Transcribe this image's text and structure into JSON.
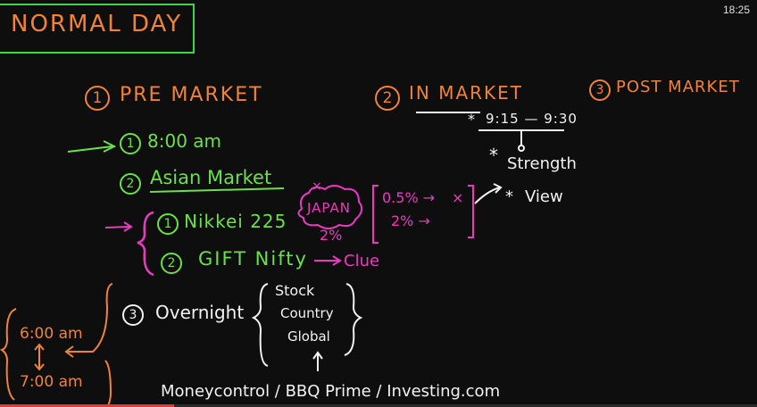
{
  "video": {
    "timestamp": "18:25",
    "progress_percent": 23
  },
  "board": {
    "title": "NORMAL DAY",
    "sections": [
      {
        "num": "1",
        "label": "PRE MARKET"
      },
      {
        "num": "2",
        "label": "IN MARKET"
      },
      {
        "num": "3",
        "label": "POST MARKET"
      }
    ],
    "pre_market": {
      "item1": {
        "num": "1",
        "text": "8:00 am"
      },
      "item2": {
        "num": "2",
        "text": "Asian Market"
      },
      "asian": [
        {
          "num": "1",
          "text": "Nikkei 225"
        },
        {
          "num": "2",
          "text": "GIFT Nifty"
        }
      ],
      "clue": "Clue",
      "japan": {
        "mark": "×",
        "label": "JAPAN",
        "pct": "2%"
      },
      "bracket": {
        "row1": "0.5% →",
        "mark1": "×",
        "row2": "2% →"
      },
      "view": "View",
      "item3": {
        "num": "3",
        "text": "Overnight"
      },
      "overnight": [
        "Stock",
        "Country",
        "Global"
      ]
    },
    "in_market": {
      "time": "9:15 — 9:30",
      "star": "*",
      "strength": "Strength",
      "view_star": "*"
    },
    "times": {
      "start": "6:00 am",
      "end": "7:00 am"
    },
    "sources": "Moneycontrol / BBQ Prime / Investing.com"
  },
  "colors": {
    "board": "#0e0e0e",
    "orange": "#f0833a",
    "green": "#6be04a",
    "pink": "#e83cc0",
    "white": "#f2f2f2",
    "progress": "#e53935"
  }
}
